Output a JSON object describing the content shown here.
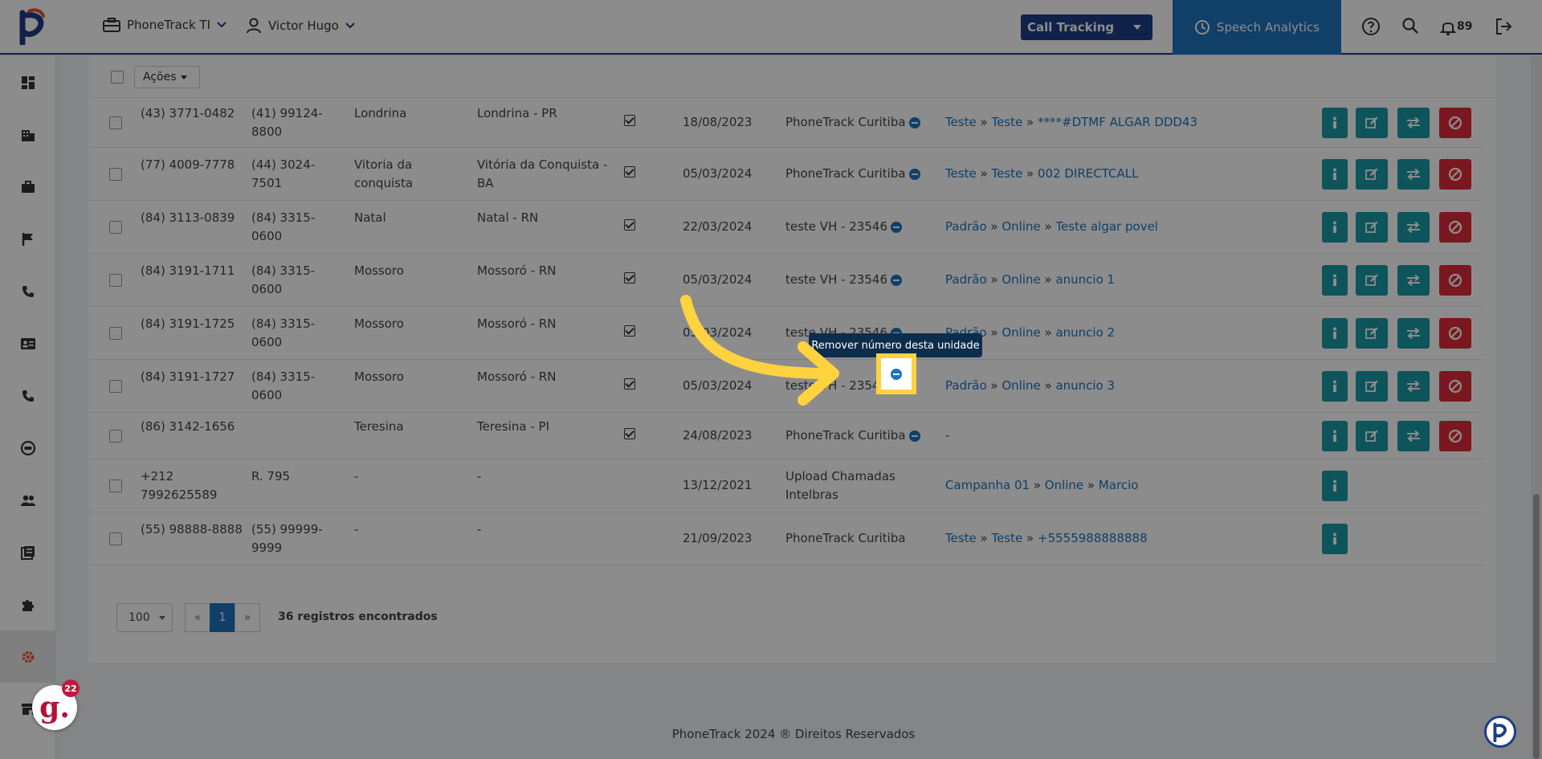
{
  "topbar": {
    "company": "PhoneTrack TI",
    "user": "Victor Hugo",
    "module_select": "Call Tracking",
    "speech_analytics": "Speech Analytics",
    "notifications": "89"
  },
  "toolbar": {
    "actions_label": "Ações"
  },
  "rows": [
    {
      "number": "(43) 3771-0482",
      "redirect": "(41) 99124-8800",
      "city": "Londrina",
      "location": "Londrina - PR",
      "checked": true,
      "date": "18/08/2023",
      "unit": "PhoneTrack Curitiba",
      "campaign": [
        "Teste",
        "Teste",
        "****#DTMF ALGAR DDD43"
      ],
      "actions": "full"
    },
    {
      "number": "(77) 4009-7778",
      "redirect": "(44) 3024-7501",
      "city": "Vitoria da conquista",
      "location": "Vitória da Conquista - BA",
      "checked": true,
      "date": "05/03/2024",
      "unit": "PhoneTrack Curitiba",
      "campaign": [
        "Teste",
        "Teste",
        "002 DIRECTCALL"
      ],
      "actions": "full"
    },
    {
      "number": "(84) 3113-0839",
      "redirect": "(84) 3315-0600",
      "city": "Natal",
      "location": "Natal - RN",
      "checked": true,
      "date": "22/03/2024",
      "unit": "teste VH - 23546",
      "campaign": [
        "Padrão",
        "Online",
        "Teste algar povel"
      ],
      "actions": "full"
    },
    {
      "number": "(84) 3191-1711",
      "redirect": "(84) 3315-0600",
      "city": "Mossoro",
      "location": "Mossoró - RN",
      "checked": true,
      "date": "05/03/2024",
      "unit": "teste VH - 23546",
      "campaign": [
        "Padrão",
        "Online",
        "anuncio 1"
      ],
      "actions": "full"
    },
    {
      "number": "(84) 3191-1725",
      "redirect": "(84) 3315-0600",
      "city": "Mossoro",
      "location": "Mossoró - RN",
      "checked": true,
      "date": "05/03/2024",
      "unit": "teste VH - 23546",
      "campaign": [
        "Padrão",
        "Online",
        "anuncio 2"
      ],
      "actions": "full"
    },
    {
      "number": "(84) 3191-1727",
      "redirect": "(84) 3315-0600",
      "city": "Mossoro",
      "location": "Mossoró - RN",
      "checked": true,
      "date": "05/03/2024",
      "unit": "teste VH - 23546",
      "campaign": [
        "Padrão",
        "Online",
        "anuncio 3"
      ],
      "actions": "full"
    },
    {
      "number": "(86) 3142-1656",
      "redirect": "",
      "city": "Teresina",
      "location": "Teresina - PI",
      "checked": true,
      "date": "24/08/2023",
      "unit": "PhoneTrack Curitiba",
      "campaign_text": "-",
      "actions": "full"
    },
    {
      "number": "+212 7992625589",
      "redirect": "R. 795",
      "city": "-",
      "location": "-",
      "checked": false,
      "date": "13/12/2021",
      "unit": "Upload Chamadas Intelbras",
      "campaign": [
        "Campanha 01",
        "Online",
        "Marcio"
      ],
      "actions": "info"
    },
    {
      "number": "(55) 98888-8888",
      "redirect": "(55) 99999-9999",
      "city": "-",
      "location": "-",
      "checked": false,
      "date": "21/09/2023",
      "unit": "PhoneTrack Curitiba",
      "campaign": [
        "Teste",
        "Teste",
        "+5555988888888"
      ],
      "actions": "info"
    }
  ],
  "pagination": {
    "per_page": "100",
    "prev": "«",
    "current": "1",
    "next": "»",
    "count_text": "36 registros encontrados"
  },
  "footer": "PhoneTrack 2024 ® Direitos Reservados",
  "tooltip": "Remover número desta unidade",
  "badge_count": "22",
  "badge_letter": "g."
}
